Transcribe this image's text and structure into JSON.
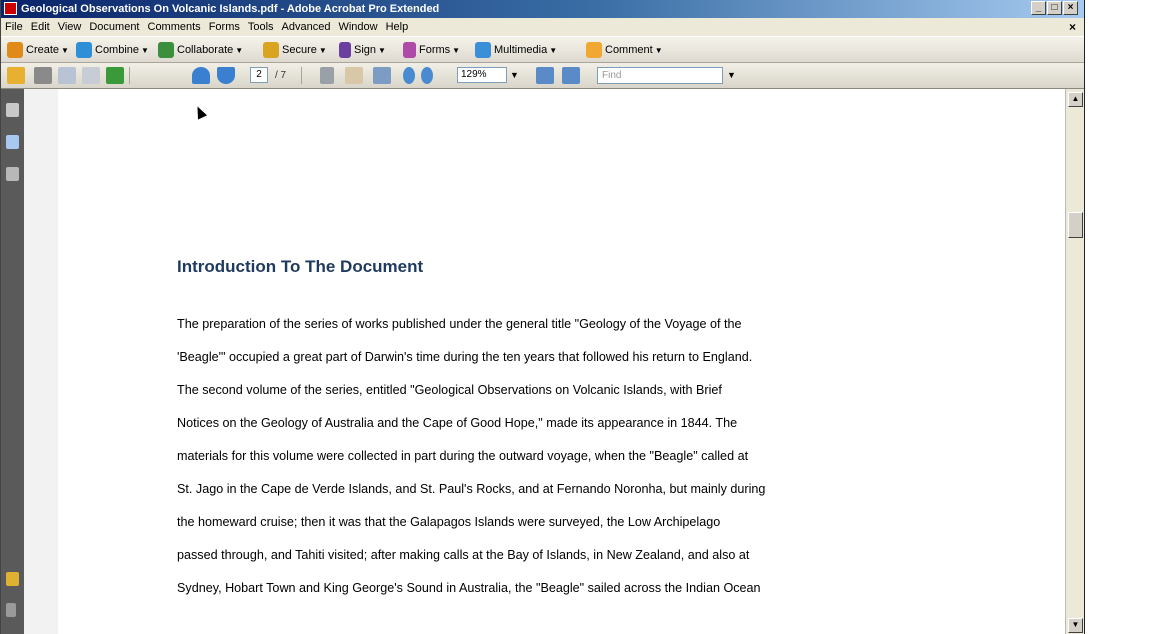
{
  "window": {
    "title": "Geological Observations On Volcanic Islands.pdf - Adobe Acrobat Pro Extended",
    "buttons": [
      "_",
      "□",
      "×"
    ]
  },
  "menu": {
    "items": [
      "File",
      "Edit",
      "View",
      "Document",
      "Comments",
      "Forms",
      "Tools",
      "Advanced",
      "Window",
      "Help"
    ],
    "close": "×"
  },
  "tasks": [
    {
      "label": "Create",
      "icon": "create-icon",
      "color": "#e08a1a"
    },
    {
      "label": "Combine",
      "icon": "combine-icon",
      "color": "#2f8fd6"
    },
    {
      "label": "Collaborate",
      "icon": "collaborate-icon",
      "color": "#3c8f3c"
    },
    {
      "label": "Secure",
      "icon": "lock-icon",
      "color": "#d9a520"
    },
    {
      "label": "Sign",
      "icon": "pen-icon",
      "color": "#6a3fa0"
    },
    {
      "label": "Forms",
      "icon": "forms-icon",
      "color": "#b04aa8"
    },
    {
      "label": "Multimedia",
      "icon": "multimedia-icon",
      "color": "#3a8fd8"
    },
    {
      "label": "Comment",
      "icon": "comment-icon",
      "color": "#f0a830"
    }
  ],
  "nav": {
    "page_current": "2",
    "page_total": "/ 7",
    "zoom": "129%",
    "find_placeholder": "Find"
  },
  "document": {
    "heading": "Introduction To The Document",
    "lines": [
      "The preparation of the series of works published under the general title \"Geology of the Voyage of the",
      "'Beagle'\" occupied a great part of Darwin's time during the ten years that followed his return to England.",
      "The second volume of the series, entitled \"Geological Observations on Volcanic Islands, with Brief",
      "Notices on the Geology of Australia and the Cape of Good Hope,\" made its appearance in 1844. The",
      "materials for this volume were collected in part during the outward voyage, when the \"Beagle\" called at",
      "St. Jago in the Cape de Verde Islands, and St. Paul's Rocks, and at Fernando Noronha, but mainly during",
      "the homeward cruise; then it was that the Galapagos Islands were surveyed, the Low Archipelago",
      "passed through, and Tahiti visited; after making calls at the Bay of Islands, in New Zealand, and also at",
      "Sydney, Hobart Town and King George's Sound in Australia, the \"Beagle\" sailed across the Indian Ocean"
    ]
  }
}
